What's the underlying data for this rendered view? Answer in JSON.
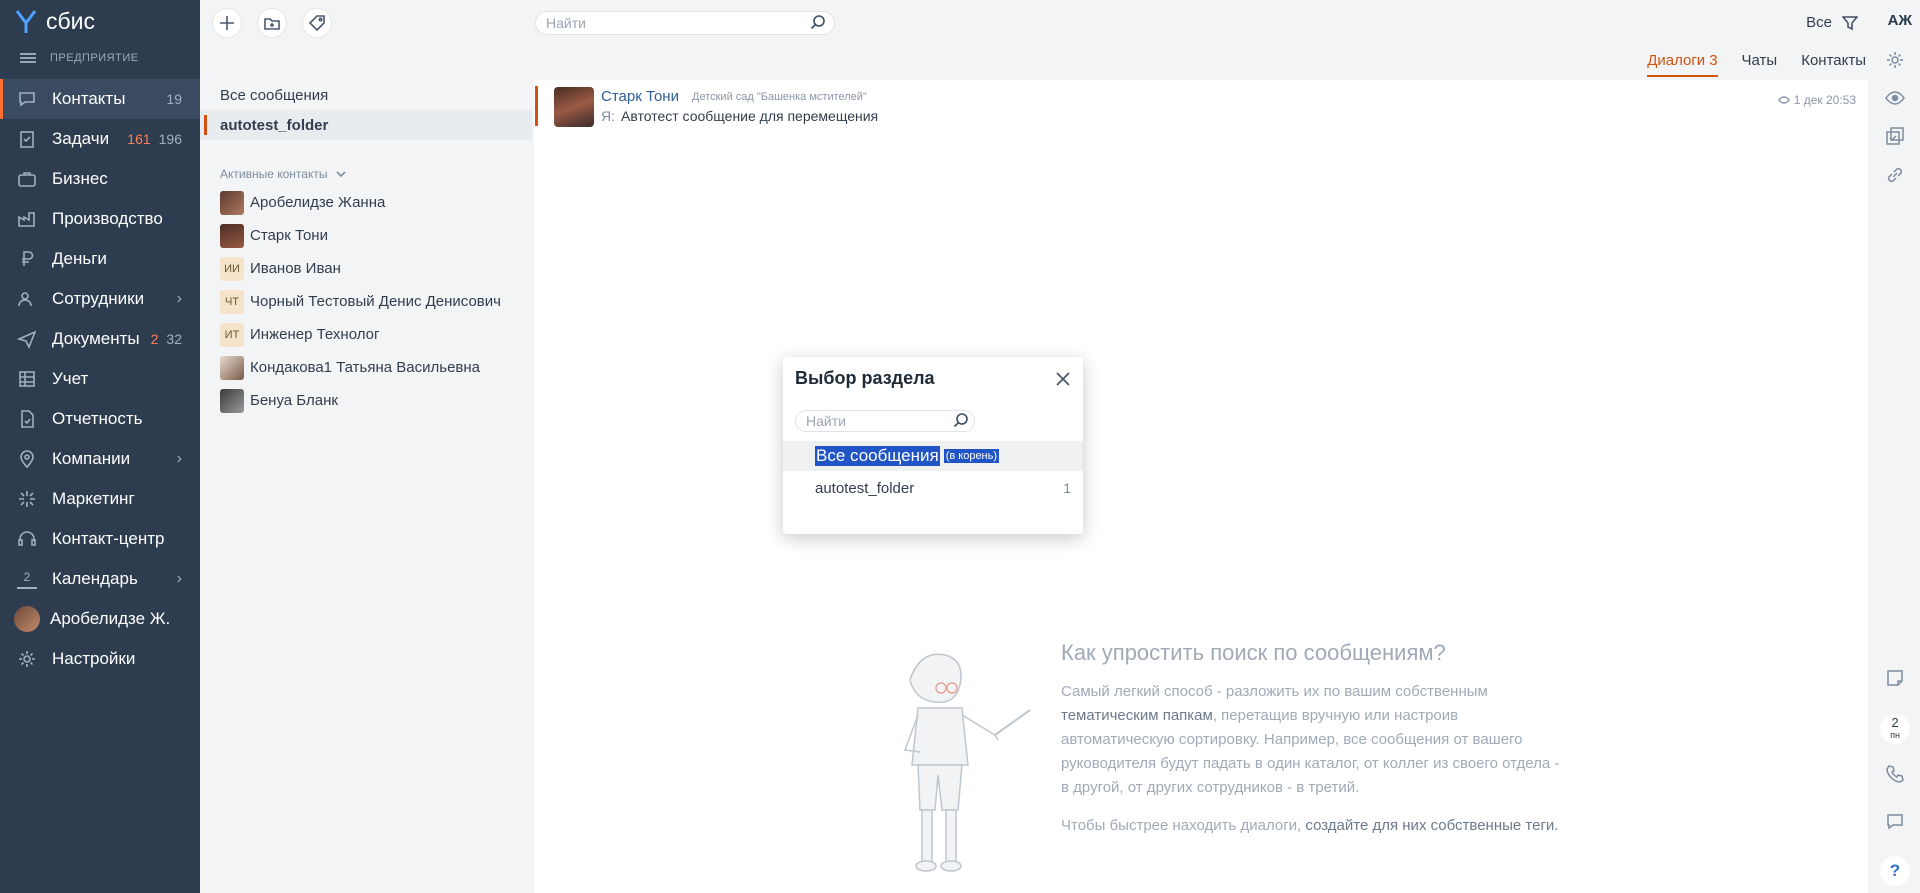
{
  "app": {
    "name": "сбис",
    "org": "ПРЕДПРИЯТИЕ"
  },
  "nav": [
    {
      "label": "Контакты",
      "count": "19"
    },
    {
      "label": "Задачи",
      "hot": "161",
      "count": "196"
    },
    {
      "label": "Бизнес"
    },
    {
      "label": "Производство"
    },
    {
      "label": "Деньги"
    },
    {
      "label": "Сотрудники"
    },
    {
      "label": "Документы",
      "hot": "2",
      "count": "32"
    },
    {
      "label": "Учет"
    },
    {
      "label": "Отчетность"
    },
    {
      "label": "Компании"
    },
    {
      "label": "Маркетинг"
    },
    {
      "label": "Контакт-центр"
    },
    {
      "label": "Календарь",
      "day": "2"
    },
    {
      "label": "Аробелидзе Ж."
    },
    {
      "label": "Настройки"
    }
  ],
  "toolbar": {
    "search_placeholder": "Найти",
    "filter_label": "Все",
    "user_initials": "АЖ"
  },
  "tabs": [
    {
      "label": "Диалоги",
      "count": "3"
    },
    {
      "label": "Чаты"
    },
    {
      "label": "Контакты"
    }
  ],
  "folders": {
    "all": "Все сообщения",
    "selected": "autotest_folder",
    "contacts_header": "Активные контакты"
  },
  "contacts": [
    {
      "name": "Аробелидзе Жанна"
    },
    {
      "name": "Старк Тони"
    },
    {
      "name": "Иванов Иван",
      "initials": "ИИ"
    },
    {
      "name": "Чорный Тестовый Денис Денисович",
      "initials": "ЧТ"
    },
    {
      "name": "Инженер Технолог",
      "initials": "ИТ"
    },
    {
      "name": "Кондакова1 Татьяна Васильевна"
    },
    {
      "name": "Бенуа Бланк"
    }
  ],
  "message": {
    "sender": "Старк Тони",
    "org": "Детский сад \"Башенка мстителей\"",
    "me": "Я:",
    "text": "Автотест сообщение для перемещения",
    "time": "1 дек 20:53"
  },
  "dialog": {
    "title": "Выбор раздела",
    "search_placeholder": "Найти",
    "root_label": "Все сообщения",
    "root_hint": "(в корень)",
    "folder_label": "autotest_folder",
    "folder_count": "1"
  },
  "hint": {
    "title": "Как упростить поиск по сообщениям?",
    "p1_a": "Самый легкий способ - разложить их по вашим собственным ",
    "p1_link": "тематическим папкам",
    "p1_b": ", перетащив вручную или настроив автоматическую сортировку. Например, все сообщения от вашего руководителя будут падать в один каталог, от коллег из своего отдела - в другой, от других сотрудников - в третий.",
    "p2_a": "Чтобы быстрее находить диалоги, ",
    "p2_link": "создайте для них собственные теги."
  },
  "rail": {
    "day_num": "2",
    "day_name": "пн",
    "help": "?"
  },
  "colors": {
    "nav_bg": "#2e3c4f",
    "accent": "#d4500f",
    "selection": "#2154c5"
  }
}
